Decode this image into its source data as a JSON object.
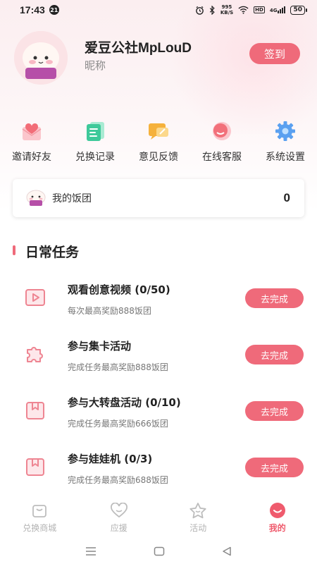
{
  "status_bar": {
    "time": "17:43",
    "notification_count": "21",
    "net_speed_value": "995",
    "net_speed_unit": "KB/S",
    "hd_label": "HD",
    "signal_label": "4G",
    "battery": "50"
  },
  "profile": {
    "username": "爱豆公社MpLouD",
    "nickname": "昵称",
    "checkin_label": "签到"
  },
  "quick_actions": [
    {
      "label": "邀请好友",
      "icon": "heart-envelope-icon",
      "color": "#f26d78"
    },
    {
      "label": "兑换记录",
      "icon": "document-icon",
      "color": "#3ec99a"
    },
    {
      "label": "意见反馈",
      "icon": "feedback-icon",
      "color": "#f5b13c"
    },
    {
      "label": "在线客服",
      "icon": "customer-service-icon",
      "color": "#f2707a"
    },
    {
      "label": "系统设置",
      "icon": "gear-icon",
      "color": "#5aa0f0"
    }
  ],
  "rice_ball": {
    "label": "我的饭团",
    "value": "0"
  },
  "daily_tasks": {
    "title": "日常任务",
    "items": [
      {
        "title": "观看创意视频 (0/50)",
        "desc": "每次最高奖励888饭团",
        "button": "去完成",
        "icon": "video-play-icon"
      },
      {
        "title": "参与集卡活动",
        "desc": "完成任务最高奖励888饭团",
        "button": "去完成",
        "icon": "puzzle-icon"
      },
      {
        "title": "参与大转盘活动 (0/10)",
        "desc": "完成任务最高奖励666饭团",
        "button": "去完成",
        "icon": "bookmark-icon"
      },
      {
        "title": "参与娃娃机 (0/3)",
        "desc": "完成任务最高奖励688饭团",
        "button": "去完成",
        "icon": "bookmark-icon"
      }
    ]
  },
  "bottom_nav": [
    {
      "label": "兑换商城",
      "icon": "shop-bag-icon",
      "active": false
    },
    {
      "label": "应援",
      "icon": "heart-icon",
      "active": false
    },
    {
      "label": "活动",
      "icon": "star-icon",
      "active": false
    },
    {
      "label": "我的",
      "icon": "smile-icon",
      "active": true
    }
  ],
  "colors": {
    "accent": "#ef6a7a",
    "active_nav": "#ef5b6d",
    "inactive_nav": "#b3b3b3"
  }
}
